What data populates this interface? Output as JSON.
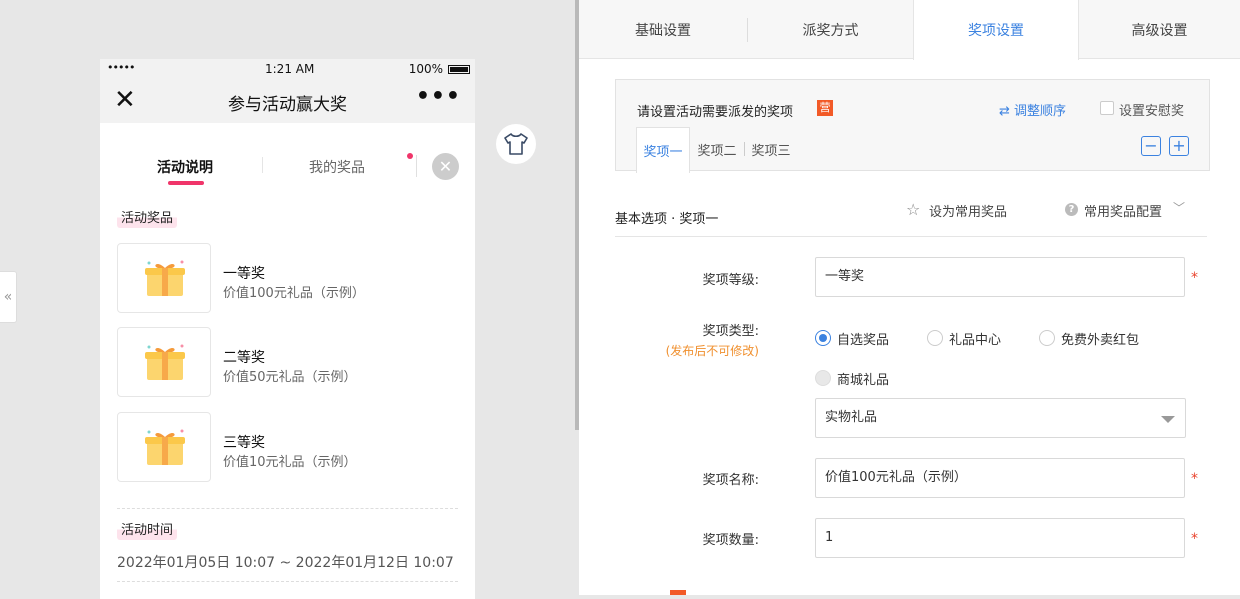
{
  "phone": {
    "status": {
      "signal": "•••••",
      "time": "1:21 AM",
      "battery": "100%"
    },
    "nav": {
      "close": "✕",
      "title": "参与活动赢大奖",
      "more": "•••"
    },
    "tabs": {
      "tab1": "活动说明",
      "tab2": "我的奖品",
      "close": "✕"
    },
    "prize_section_label": "活动奖品",
    "prizes": [
      {
        "name": "一等奖",
        "desc": "价值100元礼品（示例）"
      },
      {
        "name": "二等奖",
        "desc": "价值50元礼品（示例）"
      },
      {
        "name": "三等奖",
        "desc": "价值10元礼品（示例）"
      }
    ],
    "time_section_label": "活动时间",
    "time_range": "2022年01月05日 10:07 ~ 2022年01月12日 10:07"
  },
  "collapse_label": "«",
  "right": {
    "tabs": [
      "基础设置",
      "派奖方式",
      "奖项设置",
      "高级设置"
    ],
    "active_tab": "奖项设置",
    "prize_box": {
      "title": "请设置活动需要派发的奖项",
      "badge": "营",
      "adjust": "调整顺序",
      "consolation": "设置安慰奖",
      "subtabs": [
        "奖项一",
        "奖项二",
        "奖项三"
      ],
      "minus": "−",
      "plus": "+"
    },
    "section_title": "基本选项 · 奖项一",
    "set_favorite": "设为常用奖品",
    "favorite_config": "常用奖品配置",
    "form": {
      "level_label": "奖项等级:",
      "level_value": "一等奖",
      "type_label": "奖项类型:",
      "type_hint": "(发布后不可修改)",
      "type_options": [
        "自选奖品",
        "礼品中心",
        "免费外卖红包",
        "商城礼品"
      ],
      "type_selected": "自选奖品",
      "subtype_value": "实物礼品",
      "name_label": "奖项名称:",
      "name_value": "价值100元礼品（示例）",
      "qty_label": "奖项数量:",
      "qty_value": "1",
      "required_mark": "*"
    }
  }
}
